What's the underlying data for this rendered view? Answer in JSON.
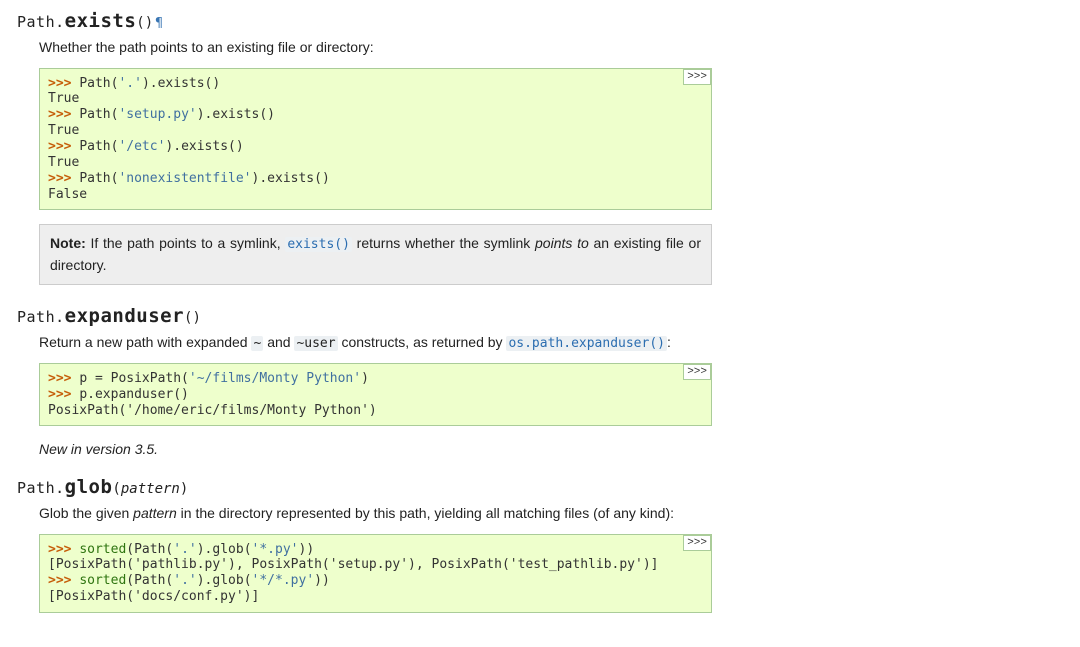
{
  "methods": {
    "exists": {
      "classname": "Path.",
      "name": "exists",
      "open": "(",
      "close": ")",
      "param": "",
      "permalink": "¶",
      "desc_prefix": "Whether the path points to an existing file or directory:",
      "copy_label": ">>>",
      "code": {
        "l1": {
          "gp": ">>> ",
          "t1": "Path(",
          "s": "'.'",
          "t2": ").exists()"
        },
        "o1": "True",
        "l2": {
          "gp": ">>> ",
          "t1": "Path(",
          "s": "'setup.py'",
          "t2": ").exists()"
        },
        "o2": "True",
        "l3": {
          "gp": ">>> ",
          "t1": "Path(",
          "s": "'/etc'",
          "t2": ").exists()"
        },
        "o3": "True",
        "l4": {
          "gp": ">>> ",
          "t1": "Path(",
          "s": "'nonexistentfile'",
          "t2": ").exists()"
        },
        "o4": "False"
      },
      "note": {
        "title": "Note:",
        "t1": " If the path points to a symlink, ",
        "code": "exists()",
        "t2": " returns whether the symlink ",
        "em": "points to",
        "t3": " an existing file or directory."
      }
    },
    "expanduser": {
      "classname": "Path.",
      "name": "expanduser",
      "open": "(",
      "close": ")",
      "param": "",
      "desc": {
        "t1": "Return a new path with expanded ",
        "c1": "~",
        "t2": " and ",
        "c2": "~user",
        "t3": " constructs, as returned by ",
        "xref": "os.path.expanduser()",
        "t4": ":"
      },
      "copy_label": ">>>",
      "code": {
        "l1": {
          "gp": ">>> ",
          "t1": "p = PosixPath(",
          "s": "'~/films/Monty Python'",
          "t2": ")"
        },
        "l2": {
          "gp": ">>> ",
          "t1": "p.expanduser()"
        },
        "o1": "PosixPath('/home/eric/films/Monty Python')"
      },
      "versionadded": "New in version 3.5."
    },
    "glob": {
      "classname": "Path.",
      "name": "glob",
      "open": "(",
      "close": ")",
      "param": "pattern",
      "desc": {
        "t1": "Glob the given ",
        "em": "pattern",
        "t2": " in the directory represented by this path, yielding all matching files (of any kind):"
      },
      "copy_label": ">>>",
      "code": {
        "l1": {
          "gp": ">>> ",
          "nb": "sorted",
          "t1": "(Path(",
          "s1": "'.'",
          "t2": ").glob(",
          "s2": "'*.py'",
          "t3": "))"
        },
        "o1": "[PosixPath('pathlib.py'), PosixPath('setup.py'), PosixPath('test_pathlib.py')]",
        "l2": {
          "gp": ">>> ",
          "nb": "sorted",
          "t1": "(Path(",
          "s1": "'.'",
          "t2": ").glob(",
          "s2": "'*/*.py'",
          "t3": "))"
        },
        "o2": "[PosixPath('docs/conf.py')]"
      }
    }
  }
}
